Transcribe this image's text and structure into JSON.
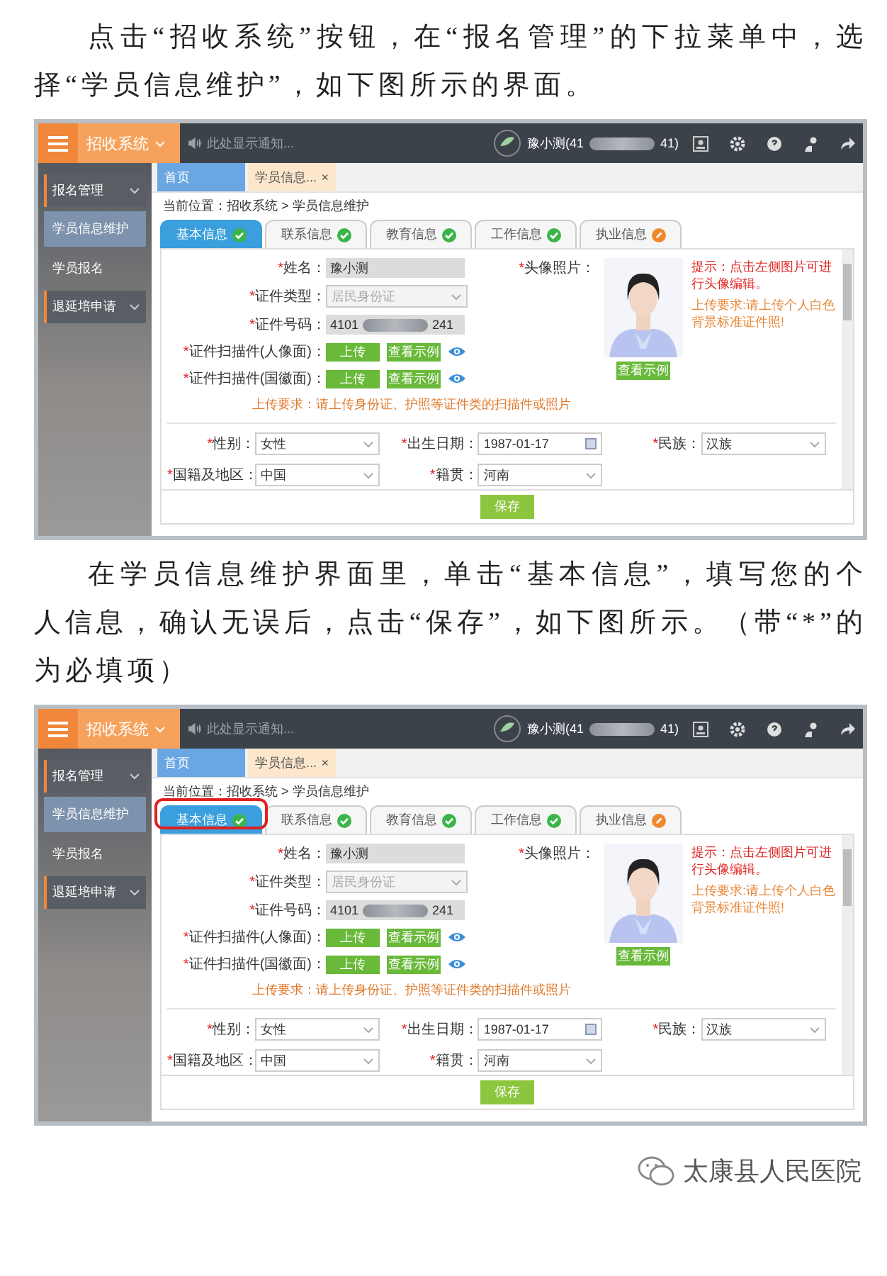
{
  "paragraphs": [
    "点击“招收系统”按钮，在“报名管理”的下拉菜单中，选择“学员信息维护”，如下图所示的界面。",
    "在学员信息维护界面里，单击“基本信息”，填写您的个人信息，确认无误后，点击“保存”，如下图所示。（带“*”的为必填项）"
  ],
  "screenshots": [
    {
      "app_menu": "招收系统",
      "notice": "此处显示通知...",
      "user": {
        "name_start": "豫小测(41",
        "name_end": "41)"
      },
      "sidebar": [
        {
          "label": "报名管理",
          "children": [
            {
              "label": "学员信息维护",
              "selected": true
            },
            {
              "label": "学员报名",
              "selected": false
            }
          ]
        },
        {
          "label": "退延培申请"
        }
      ],
      "page_tabs": [
        {
          "label": "首页",
          "selected": false
        },
        {
          "label": "学员信息...",
          "selected": true,
          "close": "×"
        }
      ],
      "breadcrumb": "当前位置：招收系统 > 学员信息维护",
      "form_tabs": [
        {
          "label": "基本信息",
          "selected": true,
          "complete": true
        },
        {
          "label": "联系信息",
          "selected": false,
          "complete": true
        },
        {
          "label": "教育信息",
          "selected": false,
          "complete": true
        },
        {
          "label": "工作信息",
          "selected": false,
          "complete": true
        },
        {
          "label": "执业信息",
          "selected": false,
          "complete": false
        }
      ],
      "fields": [
        {
          "kind": "text",
          "mark": "*",
          "label": "姓名：",
          "value": "豫小测"
        },
        {
          "kind": "select",
          "mark": "*",
          "label": "证件类型：",
          "value": "居民身份证",
          "disabled": true
        },
        {
          "kind": "masked",
          "mark": "*",
          "label": "证件号码：",
          "value_start": "4101",
          "value_end": "241"
        },
        {
          "kind": "upload",
          "mark": "*",
          "label": "证件扫描件(人像面)：",
          "buttons": [
            "上传",
            "查看示例"
          ]
        },
        {
          "kind": "upload",
          "mark": "*",
          "label": "证件扫描件(国徽面)：",
          "buttons": [
            "上传",
            "查看示例"
          ]
        }
      ],
      "upload_note": "上传要求：请上传身份证、护照等证件类的扫描件或照片",
      "photo": {
        "mark": "*",
        "label": "头像照片：",
        "button": "查看示例",
        "hint": "提示：点击左侧图片可进行头像编辑。",
        "requirement": "上传要求:请上传个人白色背景标准证件照!"
      },
      "details": [
        {
          "kind": "select",
          "mark": "*",
          "label": "性别：",
          "value": "女性"
        },
        {
          "kind": "date",
          "mark": "*",
          "label": "出生日期：",
          "value": "1987-01-17"
        },
        {
          "kind": "select",
          "mark": "*",
          "label": "民族：",
          "value": "汉族"
        },
        {
          "kind": "select",
          "mark": "*",
          "label": "国籍及地区：",
          "value": "中国"
        },
        {
          "kind": "select",
          "mark": "*",
          "label": "籍贯：",
          "value": "河南"
        }
      ],
      "save": "保存"
    },
    {
      "highlight": true,
      "app_menu": "招收系统",
      "notice": "此处显示通知...",
      "user": {
        "name_start": "豫小测(41",
        "name_end": "41)"
      },
      "sidebar": [
        {
          "label": "报名管理",
          "children": [
            {
              "label": "学员信息维护",
              "selected": true
            },
            {
              "label": "学员报名",
              "selected": false
            }
          ]
        },
        {
          "label": "退延培申请"
        }
      ],
      "page_tabs": [
        {
          "label": "首页",
          "selected": false
        },
        {
          "label": "学员信息...",
          "selected": true,
          "close": "×"
        }
      ],
      "breadcrumb": "当前位置：招收系统 > 学员信息维护",
      "form_tabs": [
        {
          "label": "基本信息",
          "selected": true,
          "complete": true
        },
        {
          "label": "联系信息",
          "selected": false,
          "complete": true
        },
        {
          "label": "教育信息",
          "selected": false,
          "complete": true
        },
        {
          "label": "工作信息",
          "selected": false,
          "complete": true
        },
        {
          "label": "执业信息",
          "selected": false,
          "complete": false
        }
      ],
      "fields": [
        {
          "kind": "text",
          "mark": "*",
          "label": "姓名：",
          "value": "豫小测"
        },
        {
          "kind": "select",
          "mark": "*",
          "label": "证件类型：",
          "value": "居民身份证",
          "disabled": true
        },
        {
          "kind": "masked",
          "mark": "*",
          "label": "证件号码：",
          "value_start": "4101",
          "value_end": "241"
        },
        {
          "kind": "upload",
          "mark": "*",
          "label": "证件扫描件(人像面)：",
          "buttons": [
            "上传",
            "查看示例"
          ]
        },
        {
          "kind": "upload",
          "mark": "*",
          "label": "证件扫描件(国徽面)：",
          "buttons": [
            "上传",
            "查看示例"
          ]
        }
      ],
      "upload_note": "上传要求：请上传身份证、护照等证件类的扫描件或照片",
      "photo": {
        "mark": "*",
        "label": "头像照片：",
        "button": "查看示例",
        "hint": "提示：点击左侧图片可进行头像编辑。",
        "requirement": "上传要求:请上传个人白色背景标准证件照!"
      },
      "details": [
        {
          "kind": "select",
          "mark": "*",
          "label": "性别：",
          "value": "女性"
        },
        {
          "kind": "date",
          "mark": "*",
          "label": "出生日期：",
          "value": "1987-01-17"
        },
        {
          "kind": "select",
          "mark": "*",
          "label": "民族：",
          "value": "汉族"
        },
        {
          "kind": "select",
          "mark": "*",
          "label": "国籍及地区：",
          "value": "中国"
        },
        {
          "kind": "select",
          "mark": "*",
          "label": "籍贯：",
          "value": "河南"
        }
      ],
      "save": "保存"
    }
  ],
  "footer": {
    "account": "太康县人民医院"
  }
}
